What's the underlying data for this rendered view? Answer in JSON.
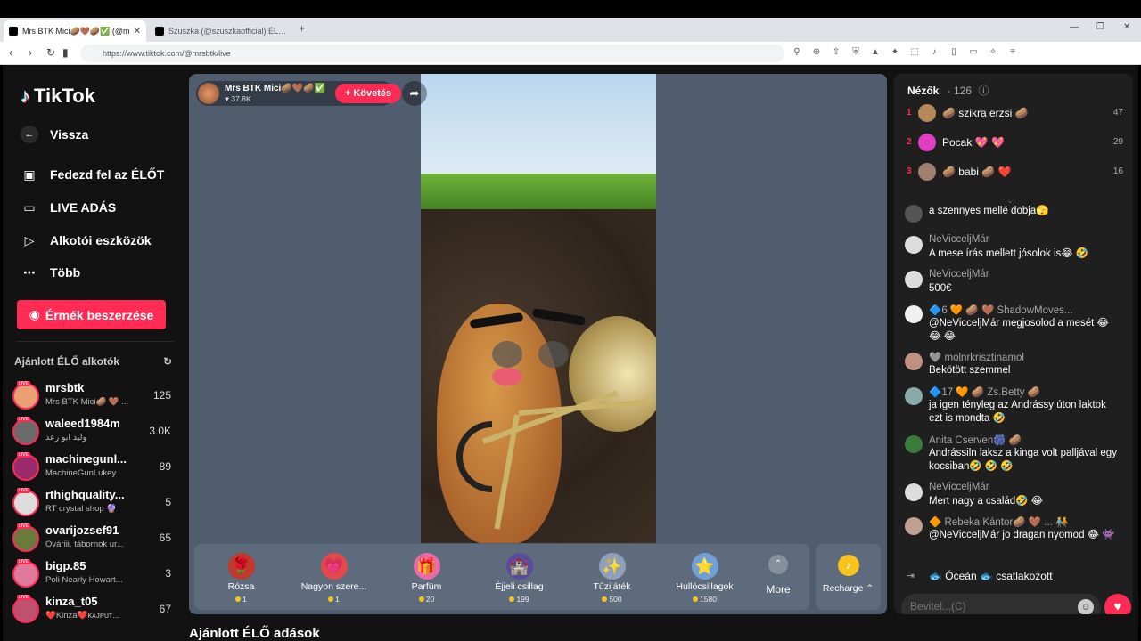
{
  "browser": {
    "tabs": [
      {
        "title": "Mrs BTK Mici🥔🤎🥔✅ (@m"
      },
      {
        "title": "Szuszka (@szuszkaofficial) ÉLŐ adás"
      }
    ],
    "new_tab": "+",
    "url": "https://www.tiktok.com/@mrsbtk/live"
  },
  "sidebar": {
    "logo": "TikTok",
    "back_label": "Vissza",
    "nav": [
      {
        "label": "Fedezd fel az ÉLŐT",
        "icon": "calendar-live-icon"
      },
      {
        "label": "LIVE ADÁS",
        "icon": "camera-icon"
      },
      {
        "label": "Alkotói eszközök",
        "icon": "creator-tools-icon"
      },
      {
        "label": "Több",
        "icon": "more-icon"
      }
    ],
    "coins_button": "Érmék beszerzése",
    "recommended_title": "Ajánlott ÉLŐ alkotók",
    "recommended": [
      {
        "name": "mrsbtk",
        "sub": "Mrs BTK Mici🥔 🤎 ...",
        "count": "125",
        "color": "#e9a073"
      },
      {
        "name": "waleed1984m",
        "sub": "وليد ابو رعد",
        "count": "3.0K",
        "color": "#6b6b6b"
      },
      {
        "name": "machinegunl...",
        "sub": "MachineGunLukey",
        "count": "89",
        "color": "#9b2a6b"
      },
      {
        "name": "rthighquality...",
        "sub": "RT crystal shop 🔮",
        "count": "5",
        "color": "#dcdcdc"
      },
      {
        "name": "ovarijozsef91",
        "sub": "Ováriii. tábornok ur...",
        "count": "65",
        "color": "#6a7a3a"
      },
      {
        "name": "bigp.85",
        "sub": "Poli Nearly Howart...",
        "count": "3",
        "color": "#e07a9a"
      },
      {
        "name": "kinza_t05",
        "sub": "❤️Kinza❤️ᴋᴀᴊᴘᴜᴛ...",
        "count": "67",
        "color": "#c05070"
      }
    ]
  },
  "stream": {
    "host_name": "Mrs BTK Mici🥔🤎🥔✅",
    "likes": "♥ 37.8K",
    "follow_label": "+ Követés",
    "gifts": [
      {
        "name": "Rózsa",
        "price": "1",
        "icon": "🌹",
        "bg": "#c0392b"
      },
      {
        "name": "Nagyon szere...",
        "price": "1",
        "icon": "💗",
        "bg": "#e24a4a"
      },
      {
        "name": "Parfüm",
        "price": "20",
        "icon": "🎁",
        "bg": "#e86aa8"
      },
      {
        "name": "Éjjeli csillag",
        "price": "199",
        "icon": "🏰",
        "bg": "#5a4c9c"
      },
      {
        "name": "Tűzijáték",
        "price": "500",
        "icon": "✨",
        "bg": "#8fa0b8"
      },
      {
        "name": "Hullócsillagok",
        "price": "1580",
        "icon": "⭐",
        "bg": "#6fa0d8"
      }
    ],
    "more_label": "More",
    "recharge_label": "Recharge ⌃",
    "bottom_title": "Ajánlott ÉLŐ adások"
  },
  "chat": {
    "viewers_title": "Nézők",
    "viewers_count": "· 126",
    "top_viewers": [
      {
        "rank": "1",
        "name": "🥔 szikra erzsi 🥔",
        "score": "47",
        "color": "#b58a5a"
      },
      {
        "rank": "2",
        "name": "Pocak 💖 💖",
        "score": "29",
        "color": "#e040c0"
      },
      {
        "rank": "3",
        "name": "🥔 babi 🥔 ❤️",
        "score": "16",
        "color": "#a08070"
      }
    ],
    "messages": [
      {
        "user": "",
        "text": "a szennyes mellé dobja🫣",
        "color": "#555"
      },
      {
        "user": "NeVicceljMár",
        "text": "A mese írás mellett jósolok is😂 🤣",
        "color": "#ddd"
      },
      {
        "user": "NeVicceljMár",
        "text": "500€",
        "color": "#ddd"
      },
      {
        "user": "🔷6 🧡 🥔 🤎 ShadowMoves...",
        "text": "@NeVicceljMár megjosolod a mesét 😂 😂 😂",
        "color": "#f0f0f0"
      },
      {
        "user": "🩶 molnrkrisztinamol",
        "text": "Bekötött szemmel",
        "color": "#c09080"
      },
      {
        "user": "🔷17 🧡 🥔 Zs.Betty 🥔",
        "text": "ja igen tényleg az Andrássy úton laktok ezt is mondta 🤣",
        "color": "#8aa"
      },
      {
        "user": "Anita Cserven🎆 🥔",
        "text": "Andrássiln laksz a kinga volt palljával egy kocsiban🤣 🤣 🤣",
        "color": "#3a7a3a"
      },
      {
        "user": "NeVicceljMár",
        "text": "Mert nagy a család🤣 😂",
        "color": "#ddd"
      },
      {
        "user": "🔶 Rebeka Kántor🥔 🤎 ... 🧑‍🤝‍🧑",
        "text": "@NeVicceljMár jo dragan nyomod 😂 👾",
        "color": "#c0a090"
      }
    ],
    "joined_text": "🐟 Óceán 🐟   csatlakozott",
    "input_placeholder": "Bevitel...(C)",
    "emoji_icon": "☺",
    "heart_icon": "♥"
  }
}
